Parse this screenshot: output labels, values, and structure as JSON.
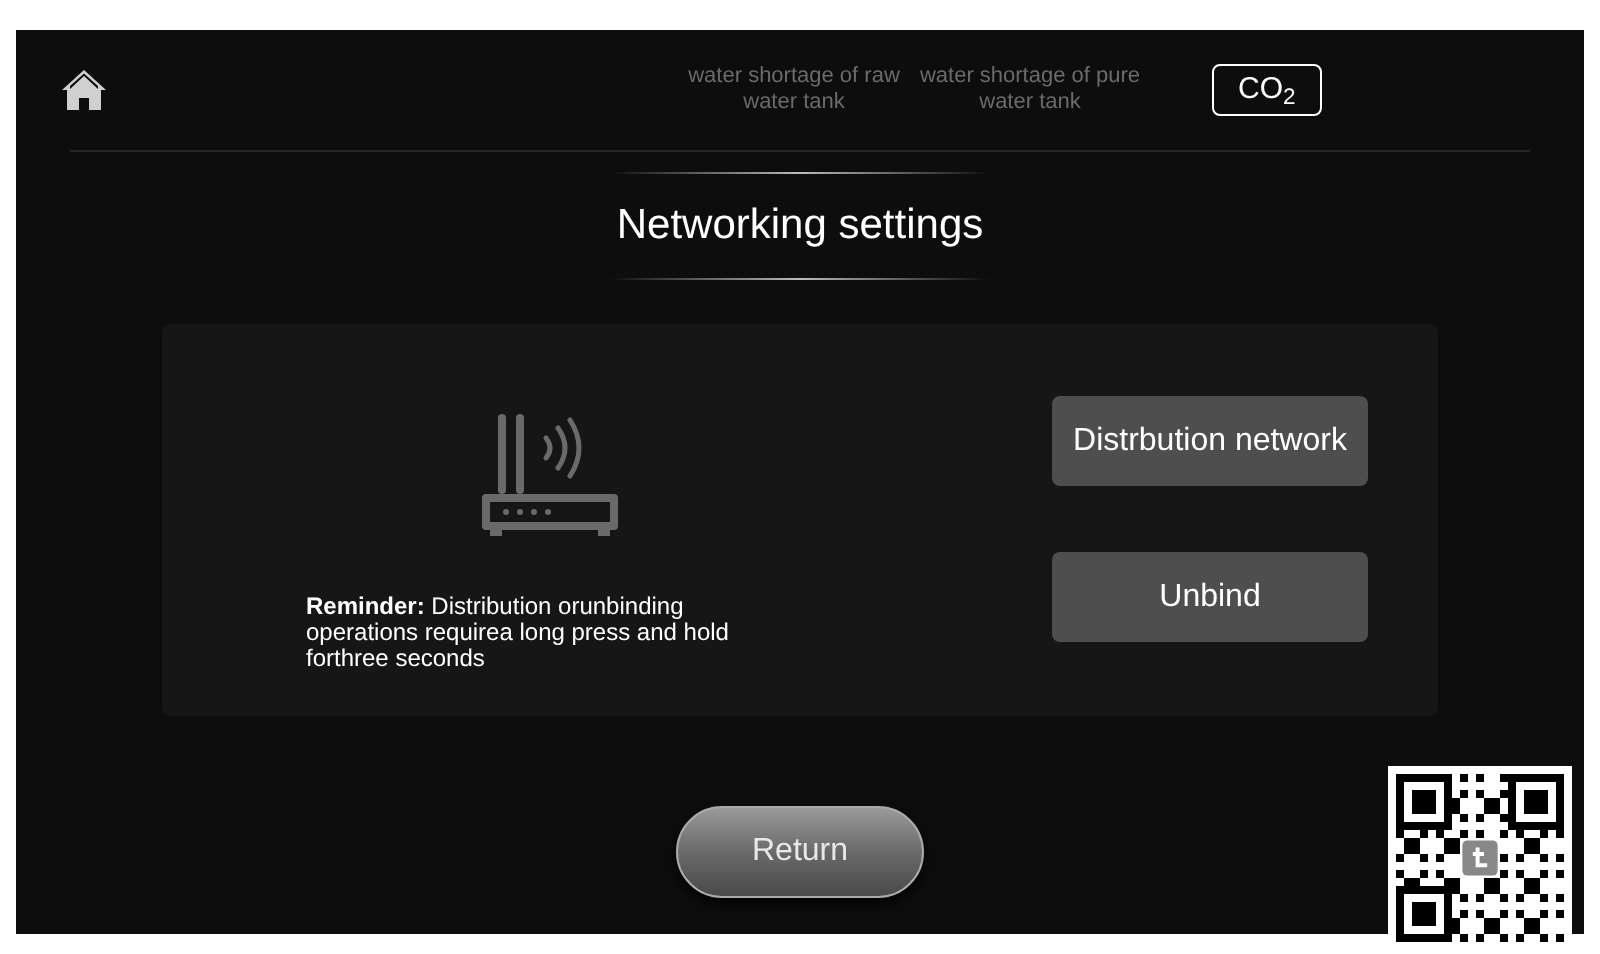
{
  "header": {
    "indicators": [
      {
        "label": "water shortage of raw water tank",
        "active": false
      },
      {
        "label": "water shortage of pure water tank",
        "active": false
      },
      {
        "label": "CO$_{2}$",
        "active": true
      }
    ]
  },
  "title": "Networking settings",
  "panel": {
    "reminder": "**Reminder:** Distribution orunbinding operations requirea long press and hold forthree seconds",
    "buttons": [
      "Distrbution network",
      "Unbind"
    ]
  },
  "return_button": "Return"
}
